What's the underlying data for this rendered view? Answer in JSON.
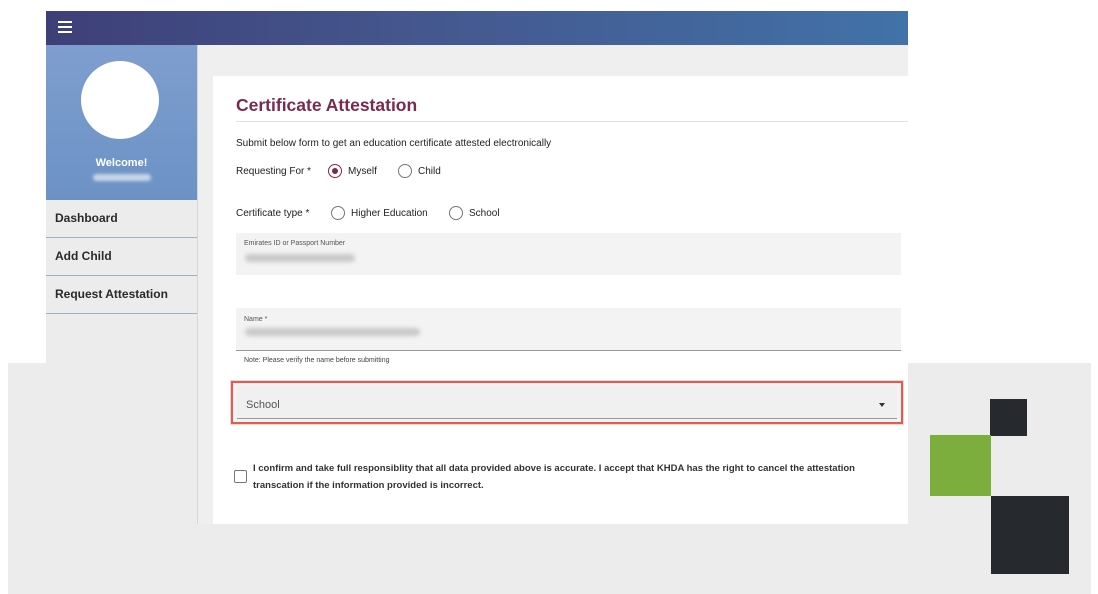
{
  "sidebar": {
    "welcome": "Welcome!",
    "items": [
      {
        "label": "Dashboard"
      },
      {
        "label": "Add Child"
      },
      {
        "label": "Request Attestation"
      }
    ]
  },
  "form": {
    "title": "Certificate Attestation",
    "intro": "Submit below form to get an education certificate attested electronically",
    "requesting_for": {
      "label": "Requesting For *",
      "options": [
        "Myself",
        "Child"
      ],
      "selected": "Myself"
    },
    "certificate_type": {
      "label": "Certificate type *",
      "options": [
        "Higher Education",
        "School"
      ],
      "selected": ""
    },
    "id_field": {
      "label": "Emirates ID or Passport Number"
    },
    "name_field": {
      "label": "Name *"
    },
    "name_note": "Note: Please verify the name before submitting",
    "school_select": {
      "value": "School"
    },
    "confirmation": "I confirm and take full responsiblity that all data provided above is accurate. I accept that KHDA has the right to cancel the attestation transcation if the information provided is incorrect."
  },
  "colors": {
    "accent": "#7a2a4e",
    "highlight_border": "#e55a4e",
    "topbar_start": "#3e3f78",
    "topbar_end": "#4172a8",
    "profile_bg": "#6c92c5",
    "deco_green": "#7cae3e",
    "deco_dark": "#262a2e"
  },
  "icons": {
    "menu": "hamburger-icon",
    "select": "caret-down-icon"
  }
}
